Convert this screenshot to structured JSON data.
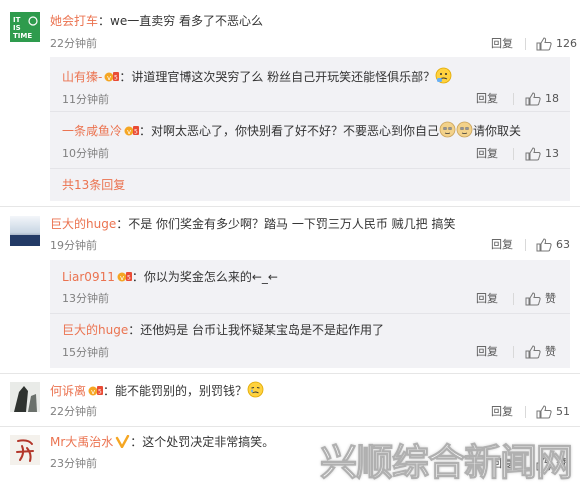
{
  "comments": [
    {
      "user": "她会打车",
      "text": "：we一直卖穷 看多了不恶心么",
      "time": "22分钟前",
      "reply_label": "回复",
      "likes": "126",
      "avatar_text": "IT IS TIME",
      "replies": [
        {
          "user": "山有獉-",
          "text": "：讲道理官博这次哭穷了么 粉丝自己开玩笑还能怪俱乐部？",
          "time": "11分钟前",
          "reply_label": "回复",
          "likes": "18"
        },
        {
          "user": "一条咸鱼冷",
          "text": "：对啊太恶心了，你快别看了好不好？不要恶心到你自己",
          "text2": "请你取关",
          "time": "10分钟前",
          "reply_label": "回复",
          "likes": "13"
        }
      ],
      "more_replies": "共13条回复"
    },
    {
      "user": "巨大的huge",
      "text": "：不是 你们奖金有多少啊？踏马 一下罚三万人民币 贼几把 搞笑",
      "time": "19分钟前",
      "reply_label": "回复",
      "likes": "63",
      "replies": [
        {
          "user": "Liar0911",
          "text": "：你以为奖金怎么来的←_←",
          "time": "13分钟前",
          "reply_label": "回复",
          "likes": "赞"
        },
        {
          "user": "巨大的huge",
          "text": "：还他妈是 台币让我怀疑某宝岛是不是起作用了",
          "time": "15分钟前",
          "reply_label": "回复",
          "likes": "赞"
        }
      ]
    },
    {
      "user": "何诉离",
      "text": "：能不能罚别的，别罚钱？",
      "time": "22分钟前",
      "reply_label": "回复",
      "likes": "51"
    },
    {
      "user": "Mr大禹治水",
      "text": "：这个处罚决定非常搞笑。",
      "time": "23分钟前",
      "reply_label": "回复",
      "likes": "赞"
    }
  ],
  "watermark": "兴顺综合新闻网",
  "colors": {
    "username": "#eb7350",
    "reply_bg": "#f2f2f5",
    "watermark": "#ffffff"
  }
}
